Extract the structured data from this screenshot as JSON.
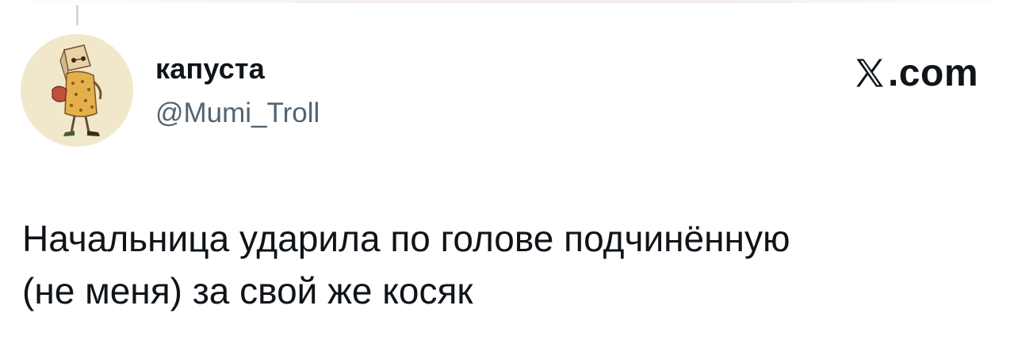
{
  "tweet": {
    "author": {
      "display_name": "капуста",
      "handle": "@Mumi_Troll",
      "avatar_icon": "paper-bag-character-avatar"
    },
    "brand": {
      "logo_icon": "x-logo-icon",
      "text": ".com"
    },
    "text_lines": [
      "Начальница ударила по голове подчинённую",
      "(не меня) за свой же косяк"
    ]
  },
  "colors": {
    "text_primary": "#0f1419",
    "text_secondary": "#536471",
    "avatar_bg": "#f1e8cb",
    "thread_line": "#cfd9de"
  }
}
